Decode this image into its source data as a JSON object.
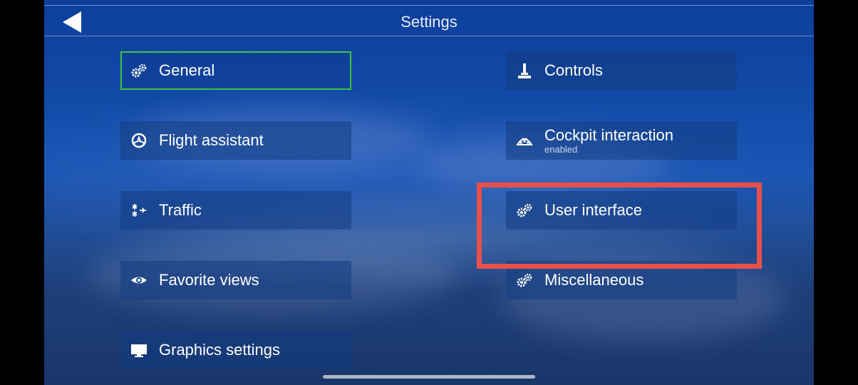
{
  "header": {
    "title": "Settings"
  },
  "tiles": {
    "general": {
      "label": "General",
      "icon": "gears-icon",
      "selected": true
    },
    "controls": {
      "label": "Controls",
      "icon": "joystick-icon"
    },
    "flight_assistant": {
      "label": "Flight assistant",
      "icon": "compass-icon"
    },
    "cockpit_interaction": {
      "label": "Cockpit interaction",
      "sublabel": "enabled",
      "icon": "cockpit-icon"
    },
    "traffic": {
      "label": "Traffic",
      "icon": "planes-icon"
    },
    "user_interface": {
      "label": "User interface",
      "icon": "gears-icon"
    },
    "favorite_views": {
      "label": "Favorite views",
      "icon": "eye-icon"
    },
    "miscellaneous": {
      "label": "Miscellaneous",
      "icon": "gears-icon"
    },
    "graphics_settings": {
      "label": "Graphics settings",
      "icon": "monitor-icon"
    }
  },
  "colors": {
    "selected_border": "#3fc33a",
    "highlight_box": "#ea4f4a",
    "text": "#ffffff"
  }
}
